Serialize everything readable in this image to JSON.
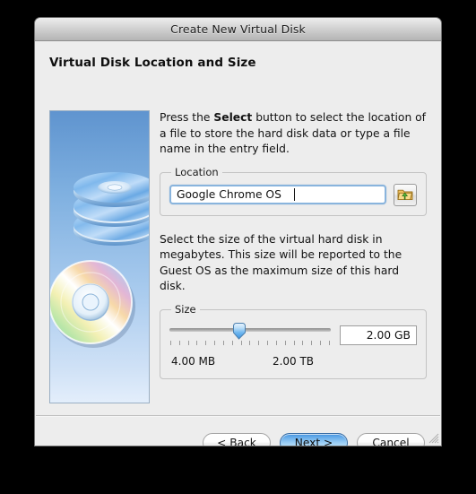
{
  "window": {
    "title": "Create New Virtual Disk",
    "page_title": "Virtual Disk Location and Size"
  },
  "banner": {
    "icon_name": "cd-stack-illustration"
  },
  "location_section": {
    "paragraph_before_bold": "Press the ",
    "paragraph_bold": "Select",
    "paragraph_after_bold": " button to select the location of a file to store the hard disk data or type a file name in the entry field.",
    "group_label": "Location",
    "field_value": "Google Chrome OS",
    "field_placeholder": "",
    "browse_button_icon": "folder-open-icon"
  },
  "size_section": {
    "paragraph": "Select the size of the virtual hard disk in megabytes. This size will be reported to the Guest OS as the maximum size of this hard disk.",
    "group_label": "Size",
    "value": "2.00 GB",
    "min_label": "4.00 MB",
    "max_label": "2.00 TB",
    "slider_percent": 43,
    "tick_count": 19
  },
  "footer": {
    "back_label": "< Back",
    "next_label": "Next >",
    "cancel_label": "Cancel"
  },
  "colors": {
    "window_bg": "#ededed",
    "accent_blue": "#5fa7e8",
    "focus_ring": "#89b4dd",
    "title_bar_top": "#eeeeee",
    "title_bar_bottom": "#b4b4b4"
  }
}
